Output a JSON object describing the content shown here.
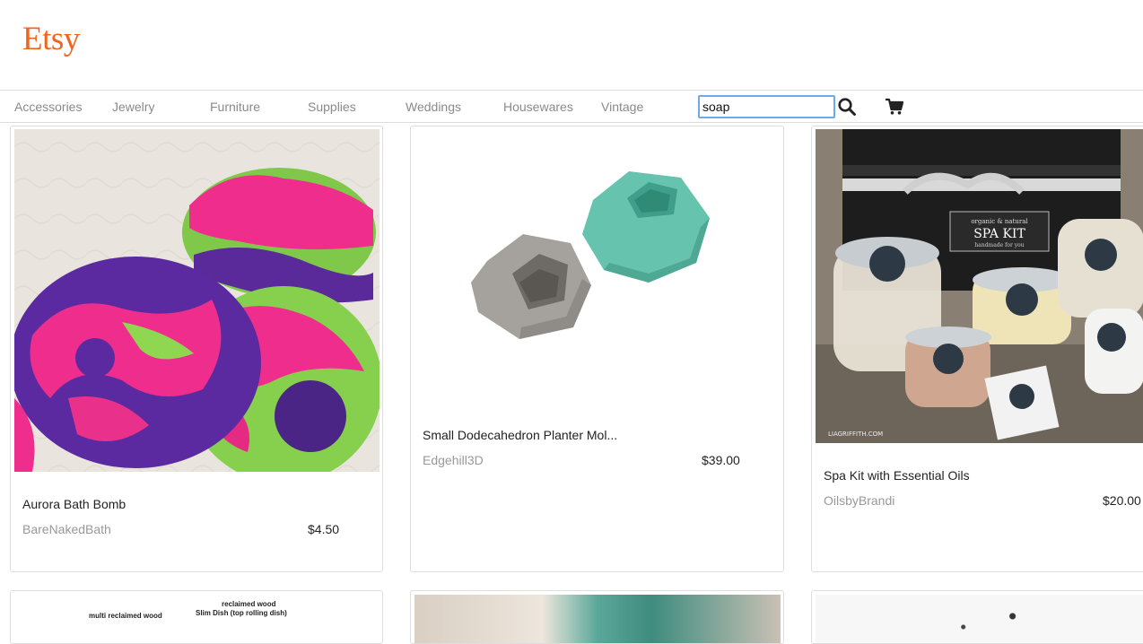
{
  "brand": {
    "logo_text": "Etsy",
    "color": "#f1641e"
  },
  "nav": {
    "categories": [
      "Accessories",
      "Jewelry",
      "Furniture",
      "Supplies",
      "Weddings",
      "Housewares",
      "Vintage"
    ]
  },
  "search": {
    "value": "soap",
    "icon": "search-icon"
  },
  "cart": {
    "icon": "cart-icon"
  },
  "listings": [
    {
      "title": "Aurora Bath Bomb",
      "shop": "BareNakedBath",
      "price": "$4.50"
    },
    {
      "title": "Small Dodecahedron Planter Mol...",
      "shop": "Edgehill3D",
      "price": "$39.00"
    },
    {
      "title": "Spa Kit with Essential Oils",
      "shop": "OilsbyBrandi",
      "price": "$20.00",
      "image_text": {
        "brand": "SPA KIT",
        "top": "organic & natural",
        "sub": "handmade for you",
        "watermark": "LIAGRIFFITH.COM"
      }
    }
  ],
  "partial_row": {
    "card4_text": {
      "line1": "reclaimed wood",
      "line2": "Slim Dish (top rolling dish)",
      "line3": "multi reclaimed wood"
    }
  }
}
